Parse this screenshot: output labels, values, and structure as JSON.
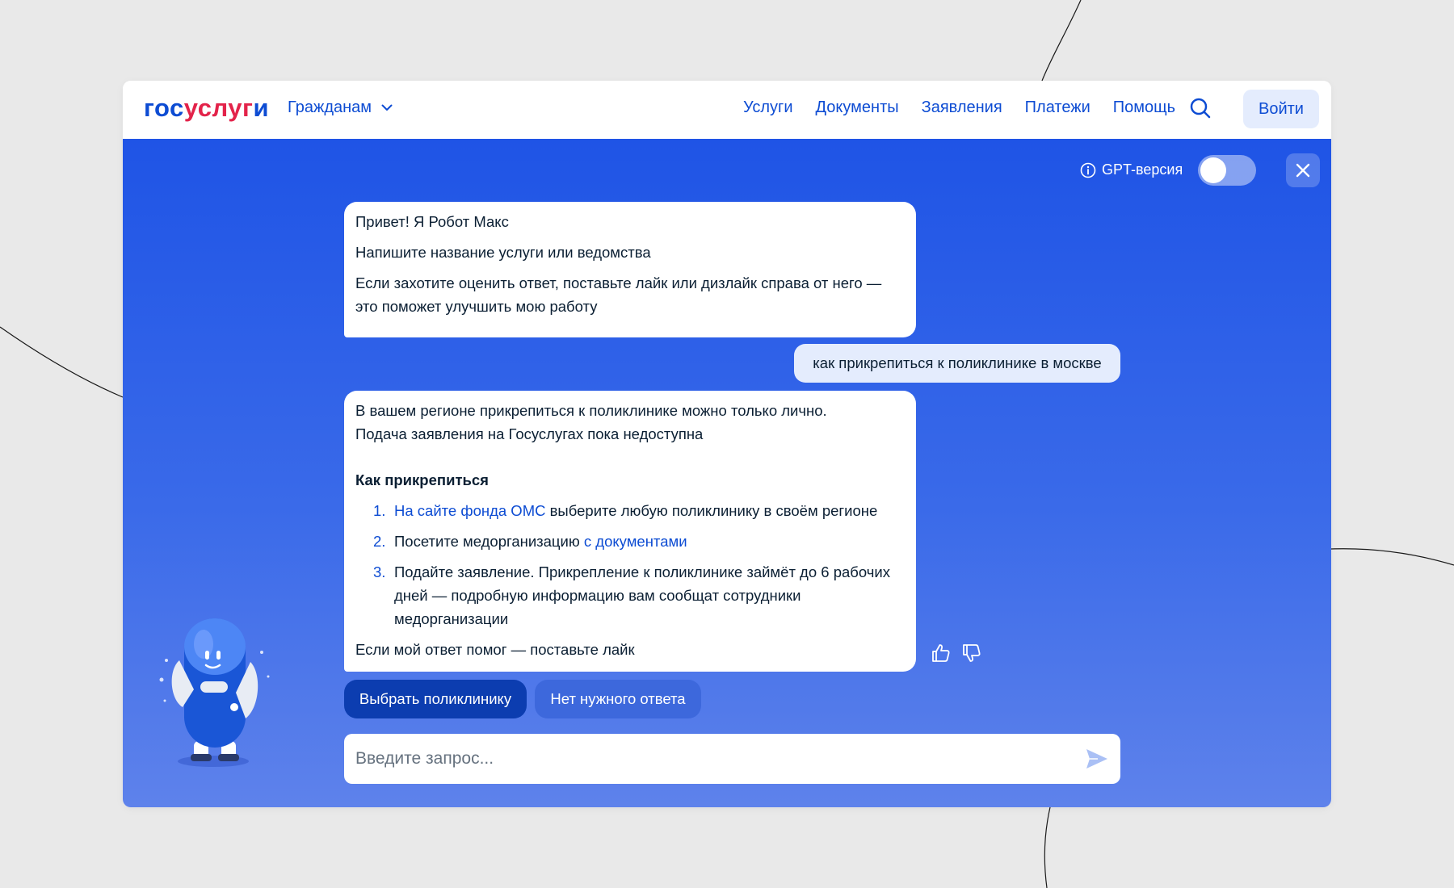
{
  "header": {
    "logo": {
      "part1": "гос",
      "part2": "услуг",
      "part3": "и"
    },
    "audience_menu": "Гражданам",
    "nav": [
      "Услуги",
      "Документы",
      "Заявления",
      "Платежи",
      "Помощь"
    ],
    "login_label": "Войти"
  },
  "chat": {
    "gpt_label": "GPT-версия",
    "gpt_enabled": false,
    "greeting": {
      "line1": "Привет! Я Робот Макс",
      "line2": "Напишите название услуги или ведомства",
      "line3": "Если захотите оценить ответ, поставьте лайк или дизлайк справа от него — это поможет улучшить мою работу"
    },
    "user_message": "как прикрепиться к поликлинике в москве",
    "answer": {
      "intro1": "В вашем регионе прикрепиться к поликлинике можно только лично.",
      "intro2": "Подача заявления на Госуслугах пока недоступна",
      "heading": "Как прикрепиться",
      "steps": [
        {
          "num": "1.",
          "link": "На сайте фонда ОМС",
          "text": " выберите любую поликлинику в своём регионе"
        },
        {
          "num": "2.",
          "text": "Посетите медорганизацию ",
          "link": "с документами"
        },
        {
          "num": "3.",
          "text": "Подайте заявление. Прикрепление к поликлинике займёт до 6 рабочих дней — подробную информацию вам сообщат сотрудники медорганизации"
        }
      ],
      "footer": "Если мой ответ помог — поставьте лайк"
    },
    "chips": [
      "Выбрать поликлинику",
      "Нет нужного ответа"
    ],
    "input_placeholder": "Введите запрос..."
  },
  "colors": {
    "brand_blue": "#0d4cd3",
    "brand_red": "#e3234a",
    "chat_gradient_top": "#1f54e6",
    "chat_gradient_bottom": "#5e82eb"
  }
}
